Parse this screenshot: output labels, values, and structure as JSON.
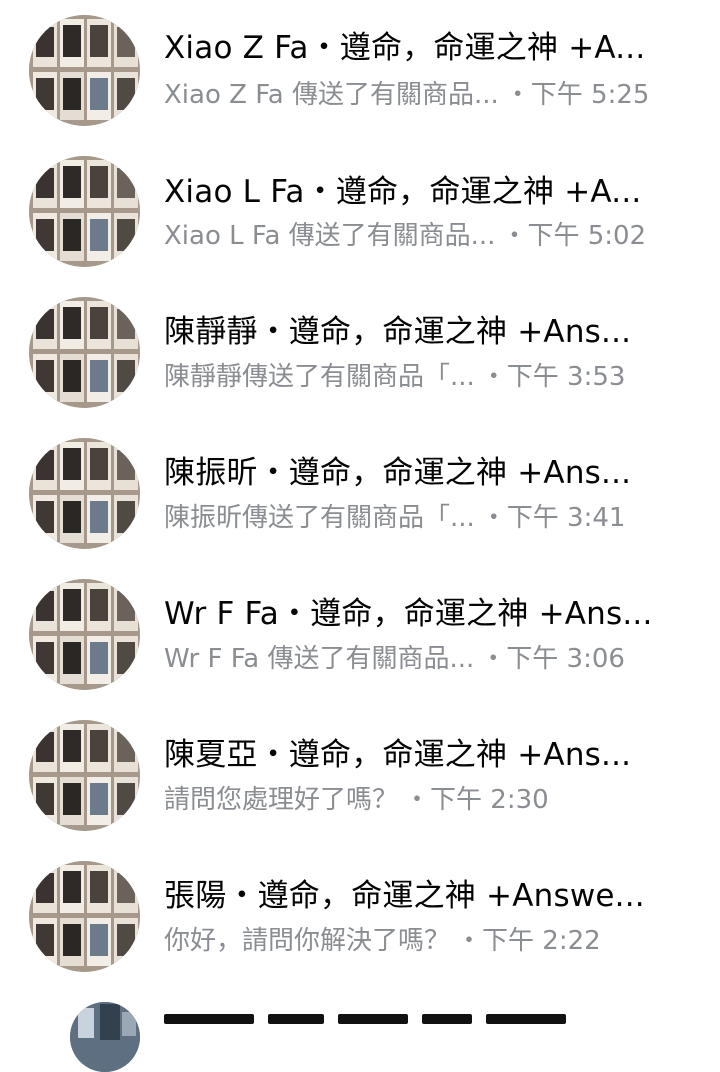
{
  "conversations": [
    {
      "title": "Xiao Z Fa・遵命，命運之神 +A...",
      "preview": "Xiao Z Fa 傳送了有關商品...",
      "time": "・下午 5:25",
      "avatar_icon": "book-collage-avatar"
    },
    {
      "title": "Xiao L Fa・遵命，命運之神 +A...",
      "preview": "Xiao L Fa 傳送了有關商品...",
      "time": "・下午 5:02",
      "avatar_icon": "book-collage-avatar"
    },
    {
      "title": "陳靜靜・遵命，命運之神 +Ans...",
      "preview": "陳靜靜傳送了有關商品「...",
      "time": "・下午 3:53",
      "avatar_icon": "book-collage-avatar"
    },
    {
      "title": "陳振昕・遵命，命運之神 +Ans...",
      "preview": "陳振昕傳送了有關商品「...",
      "time": "・下午 3:41",
      "avatar_icon": "book-collage-avatar"
    },
    {
      "title": "Wr F Fa・遵命，命運之神 +Ans...",
      "preview": "Wr F Fa 傳送了有關商品...",
      "time": "・下午 3:06",
      "avatar_icon": "book-collage-avatar"
    },
    {
      "title": "陳夏亞・遵命，命運之神 +Ans...",
      "preview": "請問您處理好了嗎？",
      "time": "・下午 2:30",
      "avatar_icon": "book-collage-avatar"
    },
    {
      "title": "張陽・遵命，命運之神 +Answe...",
      "preview": "你好，請問你解決了嗎？",
      "time": "・下午 2:22",
      "avatar_icon": "book-collage-avatar"
    }
  ],
  "colors": {
    "title": "#050505",
    "secondary": "#8a8d91",
    "background": "#ffffff"
  }
}
